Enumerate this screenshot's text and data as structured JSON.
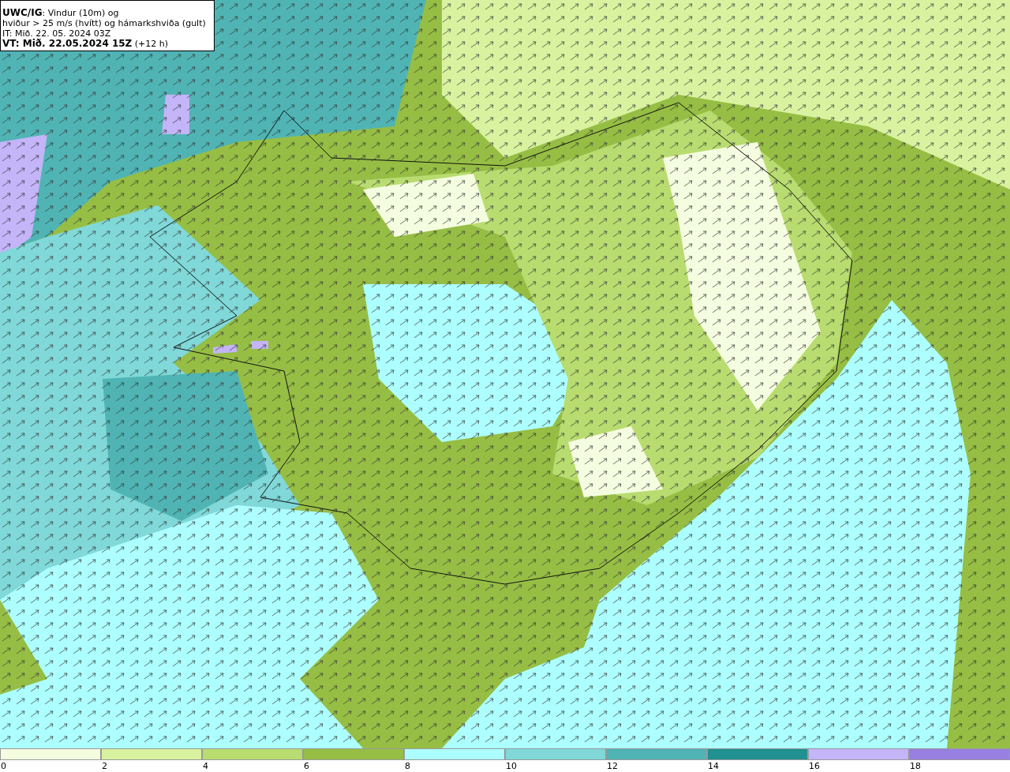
{
  "map": {
    "title_lines": [
      "**UWC/IG**: Vindur (10m) og",
      "hviður > 25 m/s (hvítt) og hámarkshviða (gult)",
      "IT: Mið. 22. 05. 2024 03Z",
      "**VT: Mið. 22.05.2024 15Z** (+12 h)"
    ]
  },
  "legend": {
    "bins": [
      {
        "color": "#f5fde0"
      },
      {
        "color": "#d9f2a0"
      },
      {
        "color": "#b8dc70"
      },
      {
        "color": "#96be44"
      },
      {
        "color": "#adffff"
      },
      {
        "color": "#80d8d8"
      },
      {
        "color": "#50b4b4"
      },
      {
        "color": "#219090"
      },
      {
        "color": "#c4b4f8"
      },
      {
        "color": "#9880e0"
      }
    ],
    "ticks": [
      "0",
      "2",
      "4",
      "6",
      "8",
      "10",
      "12",
      "14",
      "16",
      "18"
    ]
  }
}
